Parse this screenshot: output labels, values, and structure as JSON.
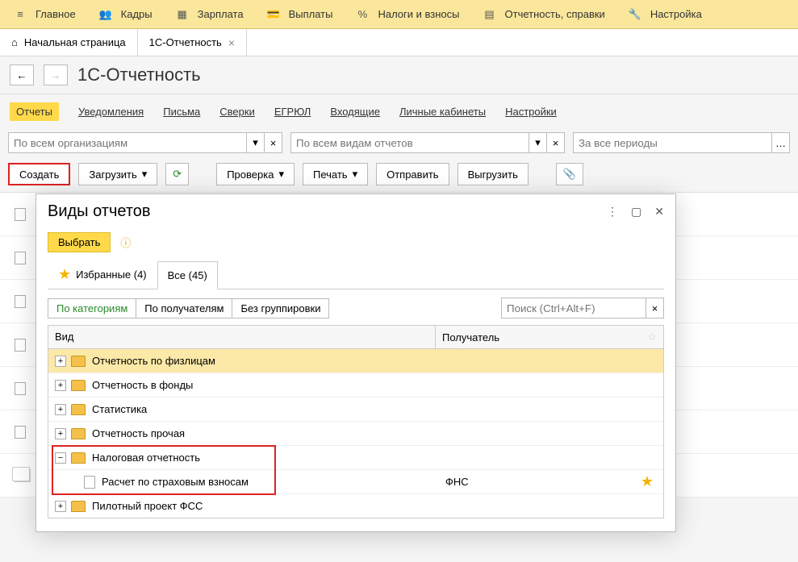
{
  "topmenu": [
    "Главное",
    "Кадры",
    "Зарплата",
    "Выплаты",
    "Налоги и взносы",
    "Отчетность, справки",
    "Настройка"
  ],
  "tabs": {
    "home": "Начальная страница",
    "active": "1С-Отчетность"
  },
  "title": "1С-Отчетность",
  "links": [
    "Отчеты",
    "Уведомления",
    "Письма",
    "Сверки",
    "ЕГРЮЛ",
    "Входящие",
    "Личные кабинеты",
    "Настройки"
  ],
  "filters": {
    "org": "По всем организациям",
    "kind": "По всем видам отчетов",
    "period": "За все периоды"
  },
  "toolbar": {
    "create": "Создать",
    "load": "Загрузить",
    "check": "Проверка",
    "print": "Печать",
    "send": "Отправить",
    "export": "Выгрузить"
  },
  "modal": {
    "title": "Виды отчетов",
    "select": "Выбрать",
    "tab_fav": "Избранные (4)",
    "tab_all": "Все (45)",
    "g_cat": "По категориям",
    "g_rcpt": "По получателям",
    "g_none": "Без группировки",
    "search_ph": "Поиск (Ctrl+Alt+F)",
    "col_kind": "Вид",
    "col_recv": "Получатель",
    "nodes": [
      {
        "label": "Отчетность по физлицам",
        "sel": true
      },
      {
        "label": "Отчетность в фонды"
      },
      {
        "label": "Статистика"
      },
      {
        "label": "Отчетность прочая"
      },
      {
        "label": "Налоговая отчетность",
        "open": true
      },
      {
        "label": "Пилотный проект ФСС"
      }
    ],
    "leaf": {
      "label": "Расчет по страховым взносам",
      "recv": "ФНС"
    }
  }
}
